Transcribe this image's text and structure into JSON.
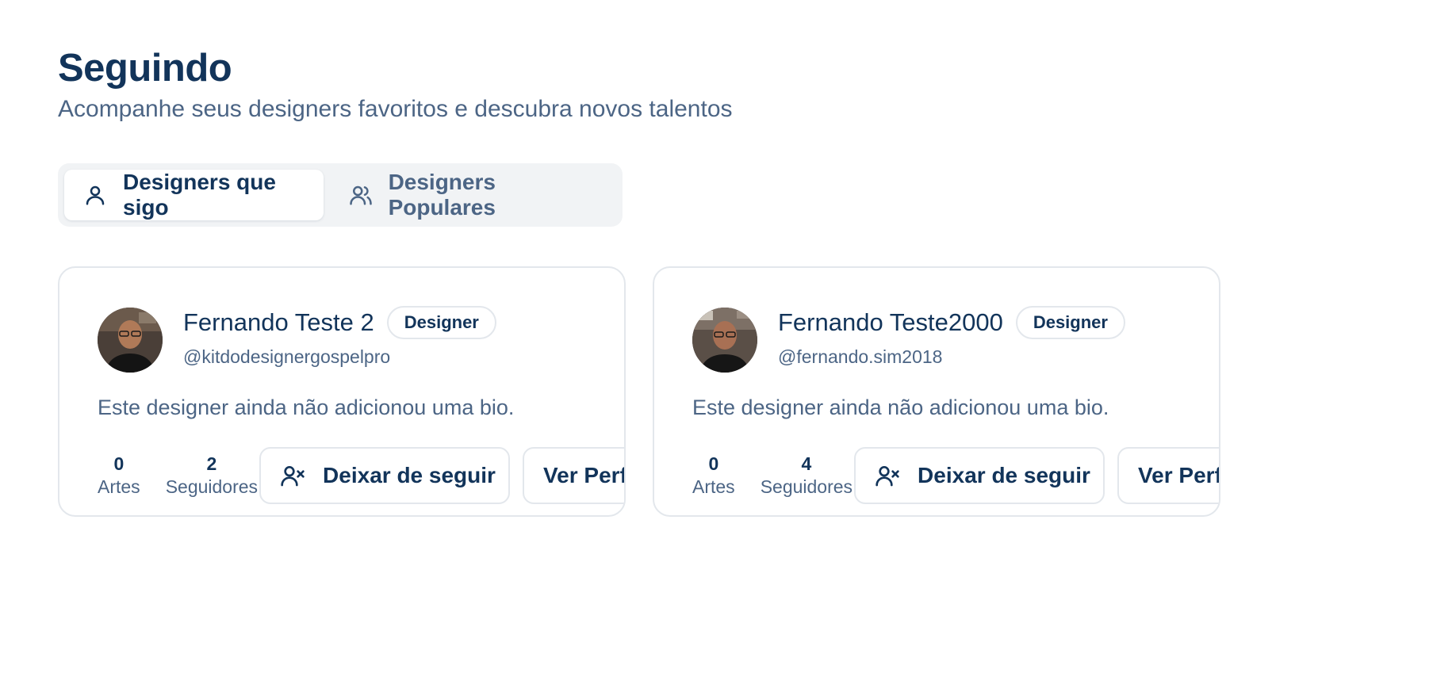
{
  "header": {
    "title": "Seguindo",
    "subtitle": "Acompanhe seus designers favoritos e descubra novos talentos"
  },
  "tabs": [
    {
      "label": "Designers que sigo",
      "icon": "user-icon",
      "active": true
    },
    {
      "label": "Designers Populares",
      "icon": "users-icon",
      "active": false
    }
  ],
  "designers": [
    {
      "name": "Fernando Teste 2",
      "role": "Designer",
      "handle": "@kitdodesignergospelpro",
      "bio": "Este designer ainda não adicionou uma bio.",
      "artworks_count": "0",
      "artworks_label": "Artes",
      "followers_count": "2",
      "followers_label": "Seguidores",
      "unfollow_label": "Deixar de seguir",
      "profile_label": "Ver Perfil"
    },
    {
      "name": "Fernando Teste2000",
      "role": "Designer",
      "handle": "@fernando.sim2018",
      "bio": "Este designer ainda não adicionou uma bio.",
      "artworks_count": "0",
      "artworks_label": "Artes",
      "followers_count": "4",
      "followers_label": "Seguidores",
      "unfollow_label": "Deixar de seguir",
      "profile_label": "Ver Perfil"
    }
  ],
  "colors": {
    "title": "#12345a",
    "muted_text": "#4c6585",
    "border": "#e3e7ec",
    "tab_bar_bg": "#f1f3f5"
  }
}
